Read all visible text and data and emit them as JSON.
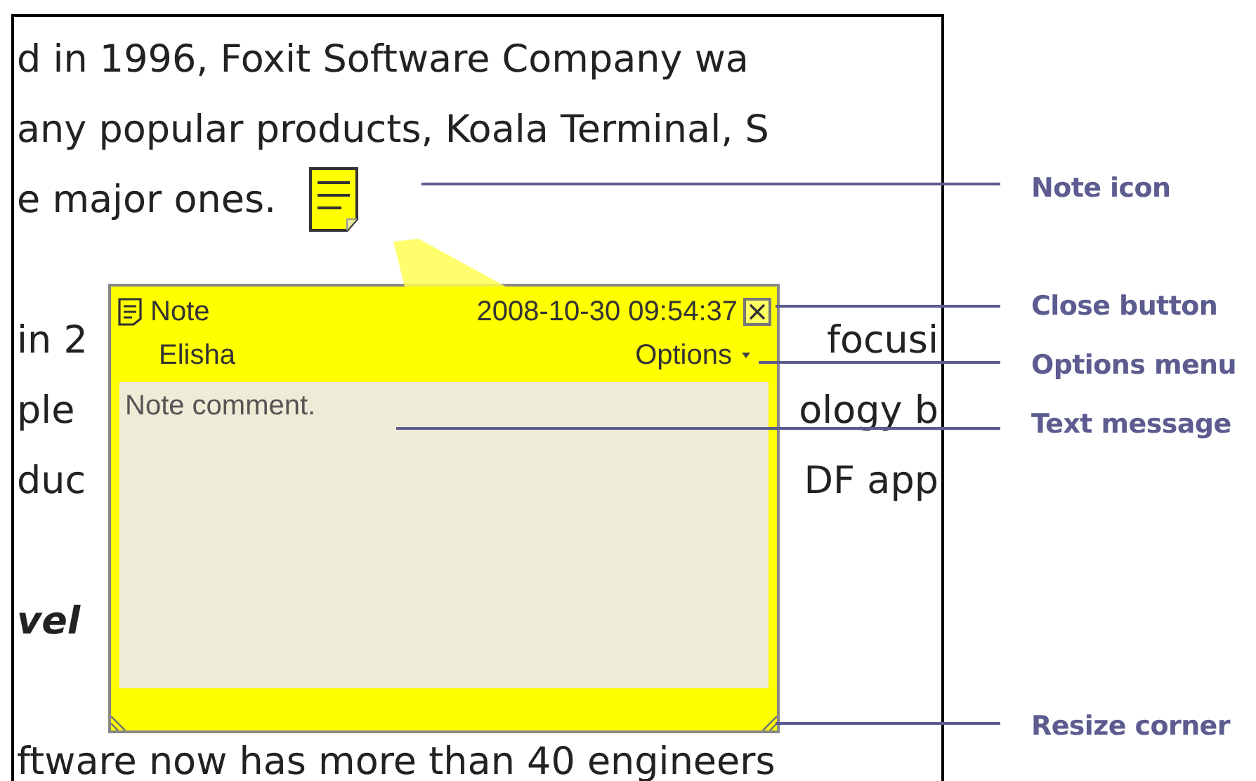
{
  "document": {
    "paragraphs": [
      {
        "kind": "body",
        "lines": [
          {
            "left": "d in 1996, Foxit Software Company wa"
          },
          {
            "left": "any popular products, Koala Terminal, S"
          },
          {
            "left": "e major ones.",
            "note_icon": true
          }
        ]
      },
      {
        "kind": "body",
        "lines": [
          {
            "left": "in 2",
            "right": "focusi"
          },
          {
            "left": "ple",
            "right": "ology b"
          },
          {
            "left": "duc",
            "right": "DF app"
          }
        ]
      },
      {
        "kind": "heading",
        "lines": [
          {
            "left": "vel"
          }
        ]
      },
      {
        "kind": "body",
        "lines": [
          {
            "left": "ftware now has more than 40 engineers"
          }
        ]
      }
    ]
  },
  "note_popup": {
    "title": "Note",
    "timestamp": "2008-10-30 09:54:37",
    "author": "Elisha",
    "options": "Options",
    "comment": "Note comment."
  },
  "callouts": [
    {
      "label": "Note icon"
    },
    {
      "label": "Close button"
    },
    {
      "label": "Options menu"
    },
    {
      "label": "Text message"
    },
    {
      "label": "Resize corner"
    }
  ]
}
